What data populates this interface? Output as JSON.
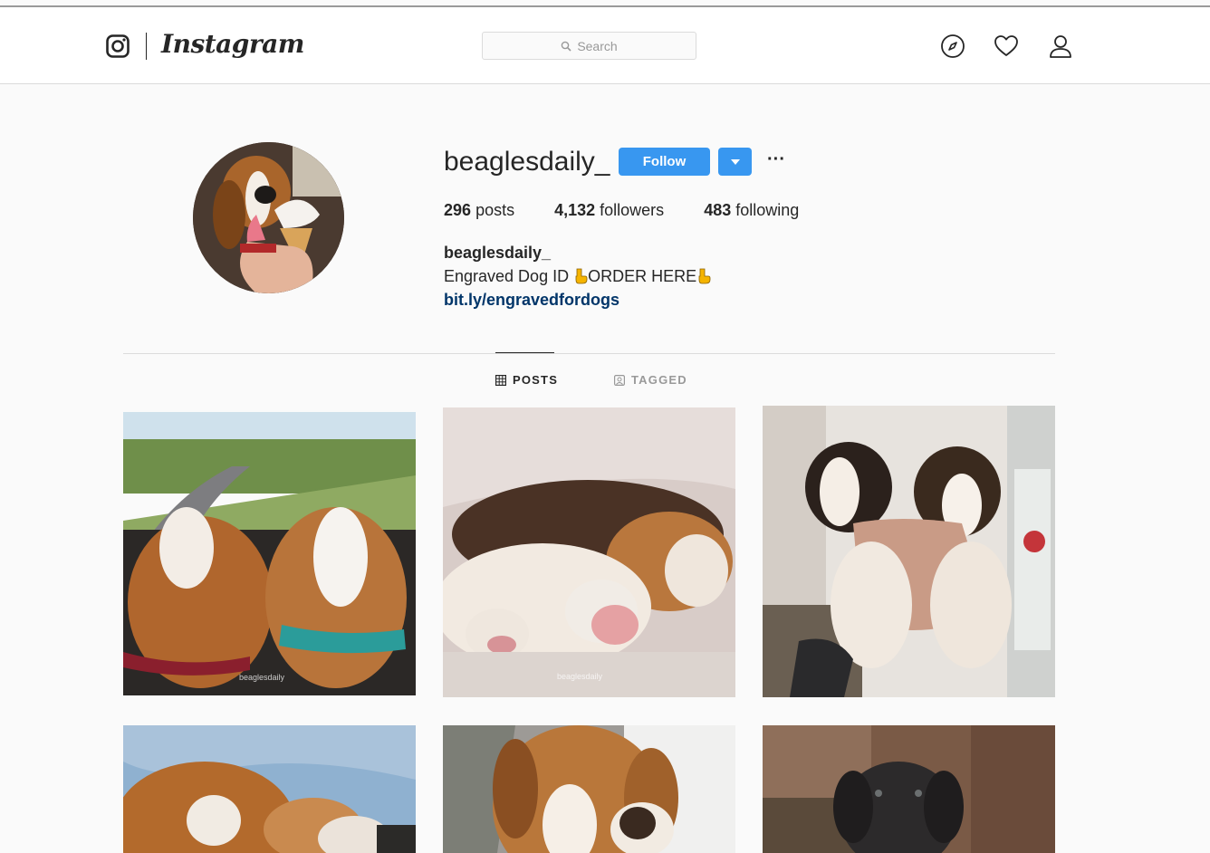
{
  "nav": {
    "brand": "Instagram",
    "search_placeholder": "Search"
  },
  "profile": {
    "username": "beaglesdaily_",
    "follow_label": "Follow",
    "more_label": "···",
    "stats": {
      "posts_count": "296",
      "posts_label": "posts",
      "followers_count": "4,132",
      "followers_label": "followers",
      "following_count": "483",
      "following_label": "following"
    },
    "bio": {
      "name": "beaglesdaily_",
      "text_part1": "Engraved Dog ID ",
      "text_part2": "ORDER HERE",
      "link": "bit.ly/engravedfordogs"
    }
  },
  "tabs": {
    "posts": "POSTS",
    "tagged": "TAGGED"
  },
  "posts": {
    "watermark_1": "beaglesdaily",
    "watermark_2": "beaglesdaily"
  },
  "colors": {
    "accent": "#3897f0",
    "link": "#003569",
    "emoji": "#f5b400"
  }
}
